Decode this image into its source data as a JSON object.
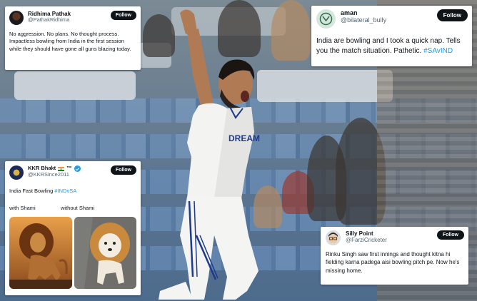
{
  "tweets": {
    "ridhima": {
      "name": "Ridhima Pathak",
      "handle": "@PathakRidhima",
      "follow_label": "Follow",
      "text": "No aggression. No plans. No thought process. Impactless bowling from India in the first session while they should have gone all guns blazing today."
    },
    "aman": {
      "name": "aman",
      "handle": "@bilateral_bully",
      "follow_label": "Follow",
      "text": "India are bowling and I took a quick nap. Tells you the match situation. Pathetic.",
      "hashtag": "#SAvIND"
    },
    "kkr": {
      "name": "KKR Bhakt",
      "name_suffix": "™",
      "handle": "@KKRSince2011",
      "follow_label": "Follow",
      "text": "India Fast Bowling",
      "hashtag": "#INDvSA",
      "label_left": "with Shami",
      "label_right": "without Shami"
    },
    "silly": {
      "name": "Silly Point",
      "handle": "@FarziCricketer",
      "follow_label": "Follow",
      "text": "Rinku Singh saw first innings and thought kitna hi fielding karna padega aisi bowling pitch pe. Now he's missing home."
    }
  },
  "jersey_text": "DREAM",
  "colors": {
    "follow_bg": "#0f1419",
    "hashtag": "#1d9bf0",
    "verified": "#1d9bf0",
    "handle": "#536471"
  },
  "icons": [
    "verified-badge-icon",
    "india-flag-icon"
  ]
}
